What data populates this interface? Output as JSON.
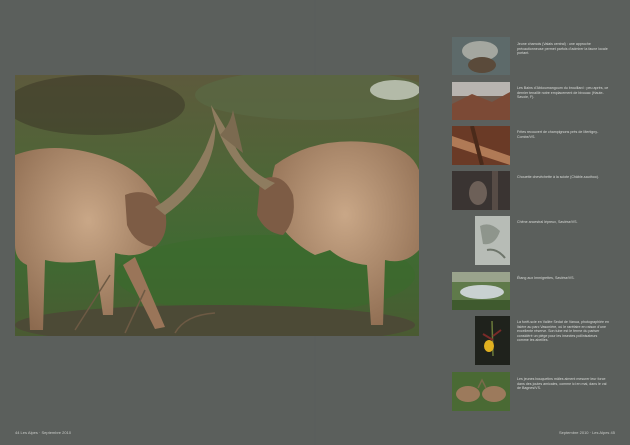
{
  "left_folio": "44 Les Alpes · Septembre 2010",
  "right_folio": "Septembre 2010 · Les Alpes 45",
  "captions": [
    "Jeune chamois (Valais central) : une approche précautionneuse permet parfois d’admirer la faune locale portant.",
    "Les Bains d’Abkoumangoum du brouillard : peu après, ce dernier tenaillé notre emplacement de bivouac (Haute-Savoie, F).",
    "Frites recouvert de champignons près de Mertigny-Combe/VS.",
    "Chouette chevêchette à la sciote (Châble-sauthoo).",
    "Chêne ancestral lépreux, Savièse/VS.",
    "Étang aux Immigrettes, Savièse/VS.",
    "La forêt-scie en Vallée Sedat de Vanua, photographiée en lisière au parc Vasonière, où le raréfaire en raison d’une excellente réserve. Son tube est le ferme du pariser considéré un piège pour les insectes pollinisateurs comme les abeilles.",
    "Les jeunes bouquetins mâles aiment mesurer leur force dans des joutes amicales, comme ici en mai, dans le val de Bagnes/VS."
  ]
}
